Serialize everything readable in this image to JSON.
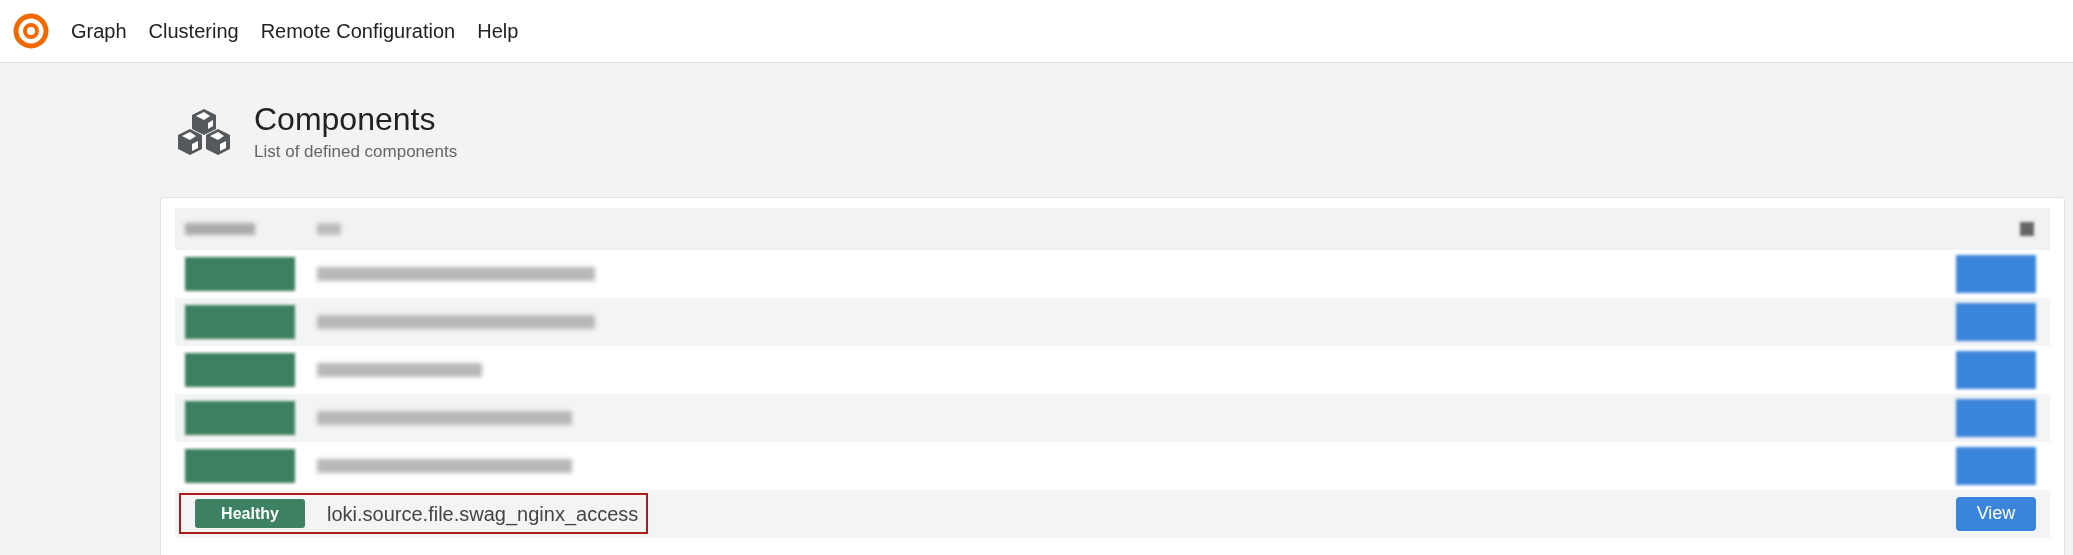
{
  "nav": {
    "items": [
      "Graph",
      "Clustering",
      "Remote Configuration",
      "Help"
    ]
  },
  "header": {
    "title": "Components",
    "subtitle": "List of defined components"
  },
  "table": {
    "header": {
      "kind": "redacted"
    },
    "rows": [
      {
        "kind": "redacted"
      },
      {
        "kind": "redacted"
      },
      {
        "kind": "redacted"
      },
      {
        "kind": "redacted"
      },
      {
        "kind": "redacted"
      },
      {
        "kind": "component",
        "health": "Healthy",
        "name": "loki.source.file.swag_nginx_access",
        "action": "View",
        "highlighted": true
      }
    ]
  }
}
